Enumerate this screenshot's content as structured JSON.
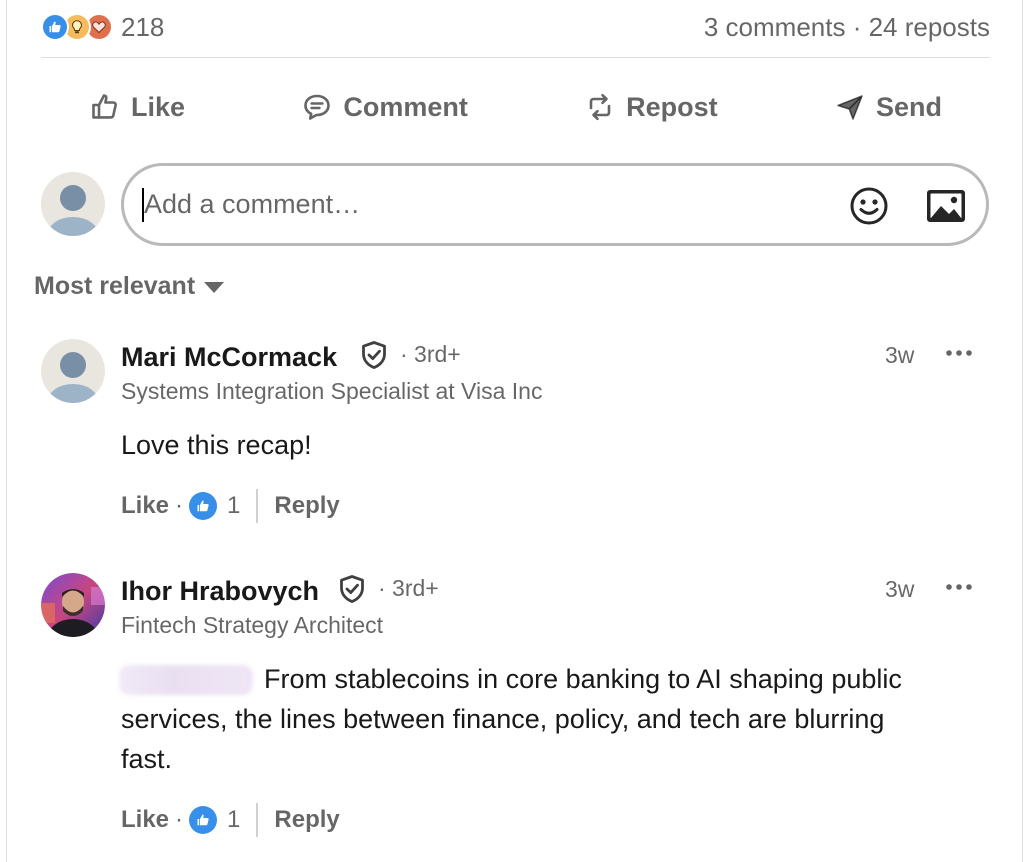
{
  "post": {
    "reaction_count": "218",
    "comments_reposts": "3 comments · 24 reposts",
    "reaction_icons": [
      "like-icon",
      "insightful-icon",
      "love-icon"
    ]
  },
  "actions": {
    "like": "Like",
    "comment": "Comment",
    "repost": "Repost",
    "send": "Send"
  },
  "composer": {
    "placeholder": "Add a comment…"
  },
  "sort": {
    "label": "Most relevant"
  },
  "comments": [
    {
      "name": "Mari McCormack",
      "degree": "· 3rd+",
      "headline": "Systems Integration Specialist at Visa Inc",
      "time": "3w",
      "text": "Love this recap!",
      "like_label": "Like",
      "separator": "·",
      "like_count": "1",
      "reply_label": "Reply"
    },
    {
      "name": "Ihor Hrabovych",
      "degree": "· 3rd+",
      "headline": "Fintech Strategy Architect",
      "time": "3w",
      "text_line1": "From stablecoins in core banking to AI shaping public",
      "text_line2": "services, the lines between finance, policy, and tech are blurring",
      "text_line3": "fast.",
      "like_label": "Like",
      "separator": "·",
      "like_count": "1",
      "reply_label": "Reply"
    }
  ],
  "colors": {
    "like_blue": "#378fe9",
    "insight_yellow": "#f5bb5c",
    "love_orange": "#df704d",
    "muted_text": "#666666"
  }
}
